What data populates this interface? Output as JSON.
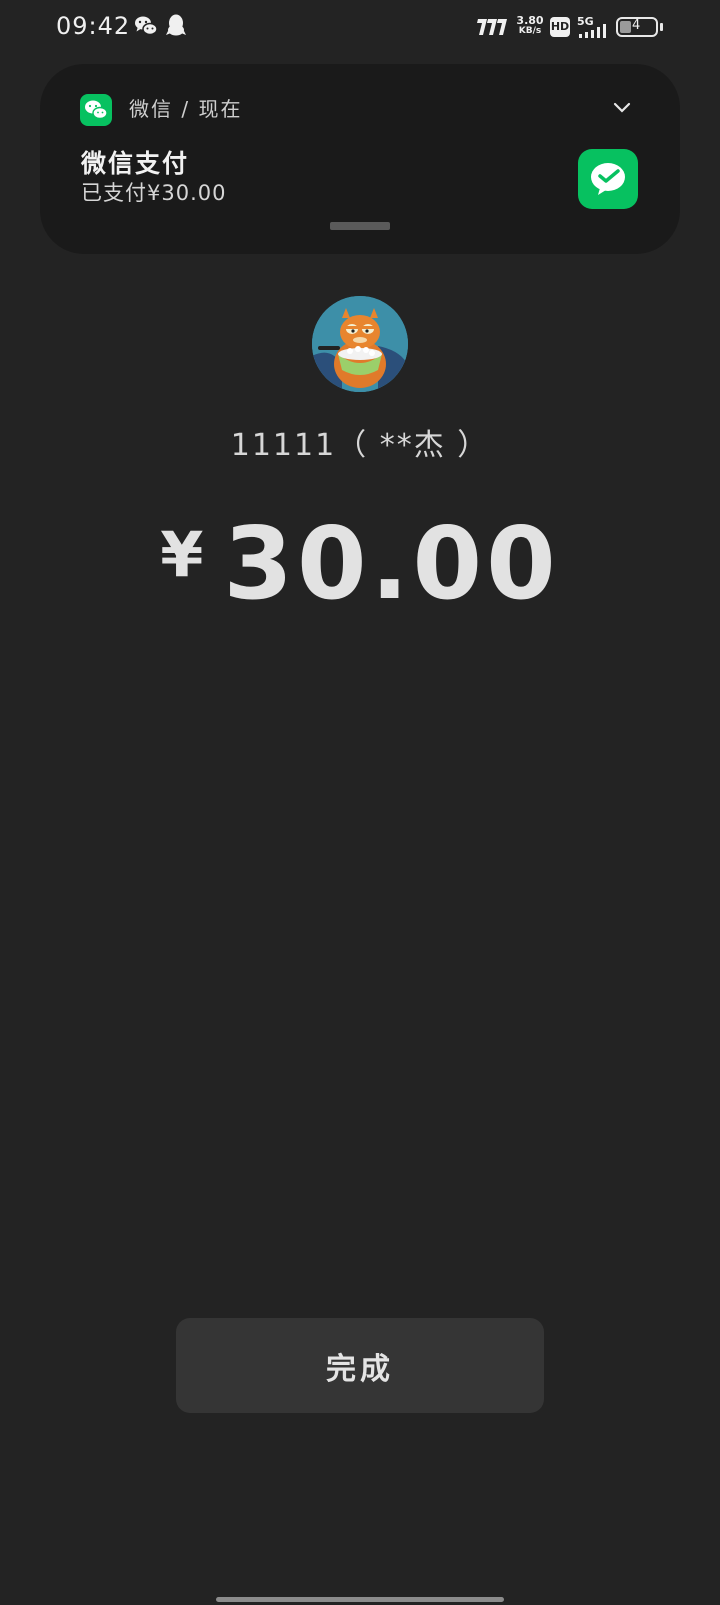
{
  "status_bar": {
    "time": "09:42",
    "net_speed_value": "3.80",
    "net_speed_unit": "KB/s",
    "hd_label": "HD",
    "signal_label": "5G",
    "battery_level": "4",
    "icons": [
      "wechat-icon",
      "qq-icon",
      "speed-icon",
      "hd-icon",
      "5g-signal-icon",
      "battery-icon"
    ]
  },
  "notification": {
    "app_line": "微信 / 现在",
    "title": "微信支付",
    "body": "已支付¥30.00",
    "accent_color": "#07c160"
  },
  "payment": {
    "payee": "11111（ **杰 ）",
    "currency_symbol": "¥",
    "amount": "30.00"
  },
  "actions": {
    "done_label": "完成"
  }
}
